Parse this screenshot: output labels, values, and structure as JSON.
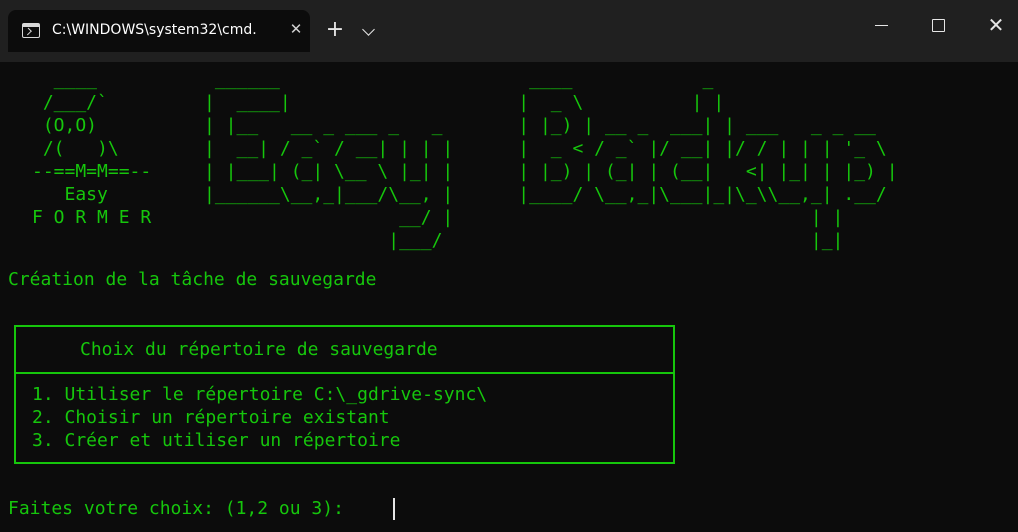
{
  "window": {
    "tab_title": "C:\\WINDOWS\\system32\\cmd.",
    "tab_close_glyph": "✕",
    "new_tab_glyph": "+",
    "close_glyph": "✕"
  },
  "console": {
    "logo_art": "  ____\n /___/`\n (O,O)\n /(   )\\\n--==M=M==--\n   Easy\nF O R M E R",
    "banner_art": " ______                       ____            _\n|  ____|                     |  _ \\          | |\n| |__   __ _ ___ _   _       | |_) | __ _  ___| | ___   _ _ __\n|  __| / _` / __| | | |      |  _ < / _` |/ __| |/ / | | | '_ \\\n| |___| (_| \\__ \\ |_| |      | |_) | (_| | (__|   <| |_| | |_) |\n|______\\__,_|___/\\__, |      |____/ \\__,_|\\___|_|\\_\\\\__,_| .__/\n                  __/ |                                 | |\n                 |___/                                  |_|",
    "heading": "Création de la tâche de sauvegarde",
    "menu": {
      "title": "Choix du répertoire de sauvegarde",
      "items": [
        "1. Utiliser le répertoire C:\\_gdrive-sync\\",
        "2. Choisir un répertoire existant",
        "3. Créer et utiliser un répertoire"
      ]
    },
    "prompt": "Faites votre choix: (1,2 ou 3):"
  },
  "colors": {
    "console_text": "#16c60c",
    "console_background": "#0c0c0c",
    "titlebar": "#202020"
  }
}
